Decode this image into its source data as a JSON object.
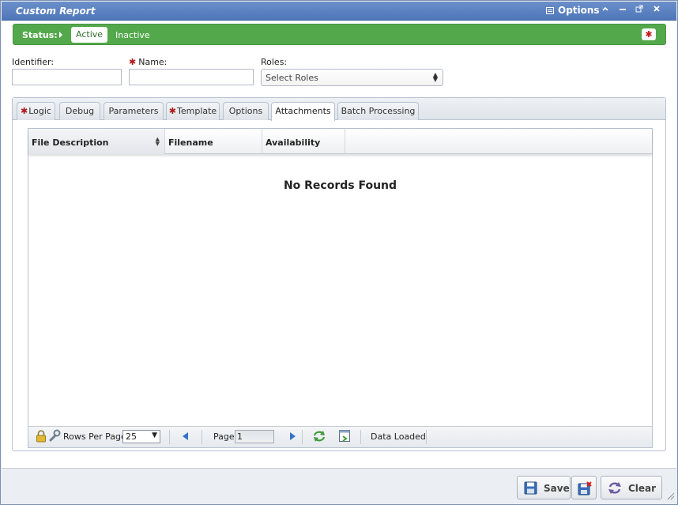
{
  "window": {
    "title": "Custom Report",
    "options_label": "Options",
    "buttons": {
      "minimize": "–",
      "restore": "–",
      "popout": "↗",
      "close": "✕"
    }
  },
  "status": {
    "label": "Status:",
    "active": "Active",
    "inactive": "Inactive",
    "required_mark": "✱"
  },
  "form": {
    "identifier_label": "Identifier:",
    "identifier_value": "",
    "name_label": "Name:",
    "name_value": "",
    "roles_label": "Roles:",
    "roles_placeholder": "Select Roles"
  },
  "tabs": [
    {
      "label": "Logic",
      "required": true
    },
    {
      "label": "Debug",
      "required": false
    },
    {
      "label": "Parameters",
      "required": false
    },
    {
      "label": "Template",
      "required": true
    },
    {
      "label": "Options",
      "required": false
    },
    {
      "label": "Attachments",
      "required": false,
      "active": true
    },
    {
      "label": "Batch Processing",
      "required": false
    }
  ],
  "grid": {
    "columns": [
      "File Description",
      "Filename",
      "Availability"
    ],
    "empty_text": "No Records Found"
  },
  "pager": {
    "rows_per_page_label": "Rows Per Page:",
    "rows_per_page_value": "25",
    "page_label": "Page:",
    "page_value": "1",
    "status_text": "Data Loaded"
  },
  "footer": {
    "save_label": "Save",
    "clear_label": "Clear"
  },
  "colors": {
    "titlebar": "#5b82c2",
    "status_bar": "#53a84b",
    "required": "#b01c1c"
  },
  "icons": [
    "options-menu-icon",
    "minimize-icon",
    "maximize-icon",
    "popout-icon",
    "close-icon",
    "lock-icon",
    "wrench-icon",
    "prev-page-icon",
    "next-page-icon",
    "refresh-icon",
    "export-icon",
    "save-icon",
    "save-close-icon",
    "clear-icon"
  ]
}
